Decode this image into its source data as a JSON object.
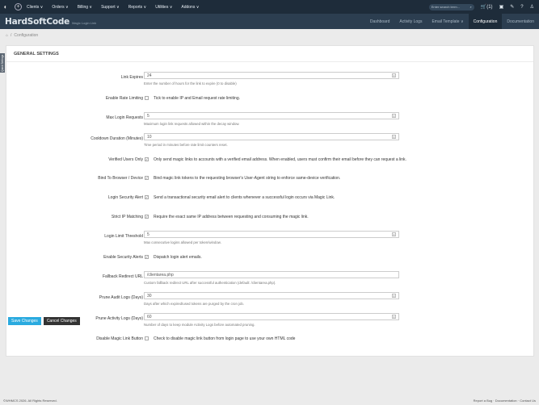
{
  "topnav": {
    "menu": [
      "Clients ∨",
      "Orders ∨",
      "Billing ∨",
      "Support ∨",
      "Reports ∨",
      "Utilities ∨",
      "Addons ∨"
    ],
    "search_placeholder": "Enter search term...",
    "cart_count": "(1)"
  },
  "module": {
    "title": "HardSoftCode",
    "subtitle": "Magic Login Link",
    "tabs": [
      "Dashboard",
      "Activity Logs",
      "Email Template ∨",
      "Configuration",
      "Documentation"
    ],
    "active_tab": "Configuration"
  },
  "breadcrumb": {
    "home": "⌂",
    "sep": "/",
    "current": "Configuration"
  },
  "side_handle": "Quick Settings",
  "panel": {
    "heading": "GENERAL SETTINGS"
  },
  "settings": [
    {
      "label": "Link Expires",
      "value": "24",
      "help": "Enter the number of hours for the link to expire (0 to disable)"
    },
    {
      "label": "Enable Rate Limiting",
      "text": "Tick to enable IP and Email request rate limiting."
    },
    {
      "label": "Max Login Requests",
      "value": "5",
      "help": "Maximum login link requests allowed within the decay window."
    },
    {
      "label": "Cooldown Duration (Minutes)",
      "value": "10",
      "help": "Time period in minutes before rate limit counters reset."
    },
    {
      "label": "Verified Users Only",
      "text": "Only send magic links to accounts with a verified email address. When enabled, users must confirm their email before they can request a link."
    },
    {
      "label": "Bind To Browser / Device",
      "text": "Bind magic link tokens to the requesting browser's User-Agent string to enforce same-device verification."
    },
    {
      "label": "Login Security Alert",
      "text": "Send a transactional security email alert to clients whenever a successful login occurs via Magic Link."
    },
    {
      "label": "Strict IP Matching",
      "text": "Require the exact same IP address between requesting and consuming the magic link."
    },
    {
      "label": "Login Limit Threshold",
      "value": "5",
      "help": "Max consecutive logins allowed per token/window."
    },
    {
      "label": "Enable Security Alerts",
      "text": "Dispatch login alert emails."
    },
    {
      "label": "Fallback Redirect URL",
      "value": "/clientarea.php",
      "help": "Custom fallback redirect URL after successful authentication (default: /clientarea.php)."
    },
    {
      "label": "Prune Audit Logs (Days)",
      "value": "30",
      "help": "Days after which expired/used tokens are purged by the cron job."
    },
    {
      "label": "Prune Activity Logs (Days)",
      "value": "60",
      "help": "Number of days to keep module Activity Logs before automated pruning."
    },
    {
      "label": "Disable Magic Link Button",
      "text": "Check to disable magic link button from login page to use your own HTML code"
    }
  ],
  "buttons": {
    "save": "Save Changes",
    "cancel": "Cancel Changes"
  },
  "footer": {
    "copyright": "©WHMCS 2026. All Rights Reserved.",
    "links": "Report a Bug  ·  Documentation  ·  Contact Us"
  },
  "colors": {
    "topnav": "#1e2c3a",
    "modbar": "#2c3e50",
    "accent": "#2aaadf"
  }
}
